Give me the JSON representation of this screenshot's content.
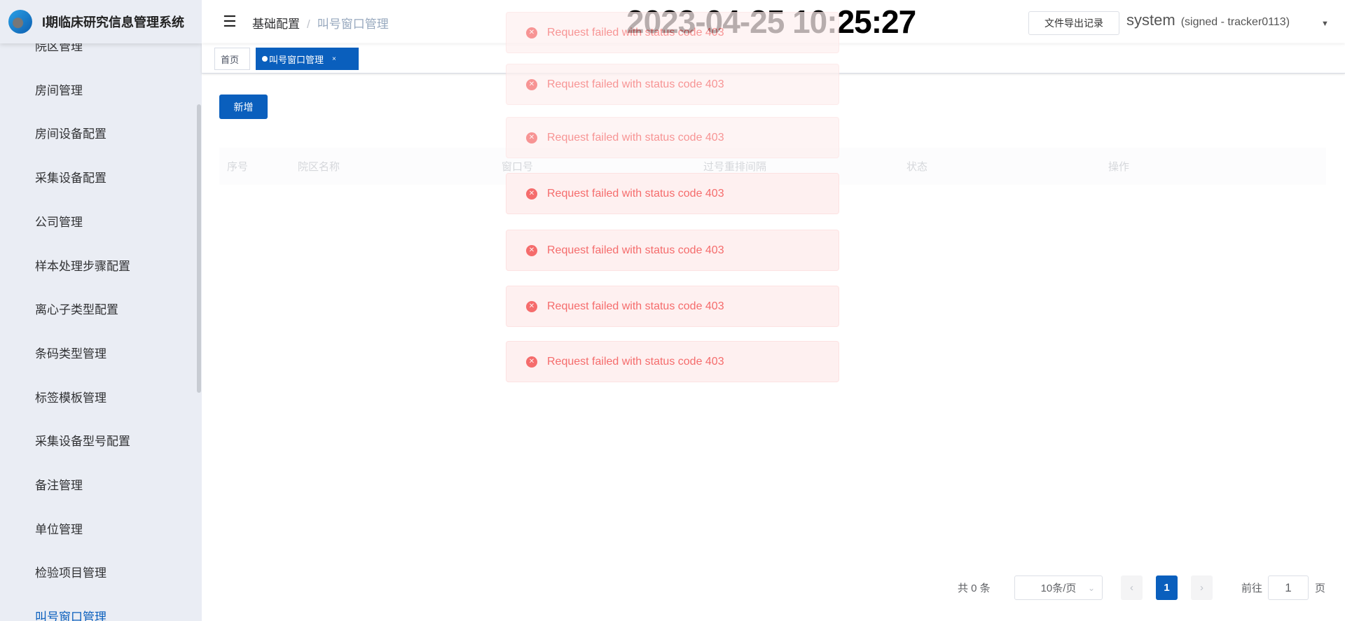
{
  "app": {
    "title": "I期临床研究信息管理系统"
  },
  "sidebar": {
    "items": [
      {
        "label": "院区管理"
      },
      {
        "label": "房间管理"
      },
      {
        "label": "房间设备配置"
      },
      {
        "label": "采集设备配置"
      },
      {
        "label": "公司管理"
      },
      {
        "label": "样本处理步骤配置"
      },
      {
        "label": "离心子类型配置"
      },
      {
        "label": "条码类型管理"
      },
      {
        "label": "标签模板管理"
      },
      {
        "label": "采集设备型号配置"
      },
      {
        "label": "备注管理"
      },
      {
        "label": "单位管理"
      },
      {
        "label": "检验项目管理"
      },
      {
        "label": "叫号窗口管理",
        "active": true
      }
    ]
  },
  "header": {
    "breadcrumb": [
      "基础配置",
      "叫号窗口管理"
    ],
    "breadcrumb_sep": "/",
    "clock": "2023-04-25 10:25:27",
    "export_label": "文件导出记录",
    "user": "system",
    "user_sub": "(signed - tracker0113)",
    "caret": "▼",
    "menu_icon": "☰"
  },
  "tabs": [
    {
      "label": "首页"
    },
    {
      "label": "叫号窗口管理",
      "close": "×",
      "active": true
    }
  ],
  "main": {
    "add_label": "新增",
    "columns": [
      "序号",
      "院区名称",
      "窗口号",
      "过号重排间隔",
      "状态",
      "操作"
    ]
  },
  "toasts": [
    {
      "text": "Request failed with status code 403",
      "faded": true
    },
    {
      "text": "Request failed with status code 403",
      "faded": true
    },
    {
      "text": "Request failed with status code 403",
      "faded": true
    },
    {
      "text": "Request failed with status code 403"
    },
    {
      "text": "Request failed with status code 403"
    },
    {
      "text": "Request failed with status code 403"
    },
    {
      "text": "Request failed with status code 403"
    }
  ],
  "pagination": {
    "total": "共 0 条",
    "page_size": "10条/页",
    "current": "1",
    "goto_label": "前往",
    "goto_value": "1",
    "page_suffix": "页"
  },
  "colors": {
    "primary": "#0a5fbd",
    "error": "#f56c6c",
    "sidebar_bg": "#eaedf4"
  }
}
